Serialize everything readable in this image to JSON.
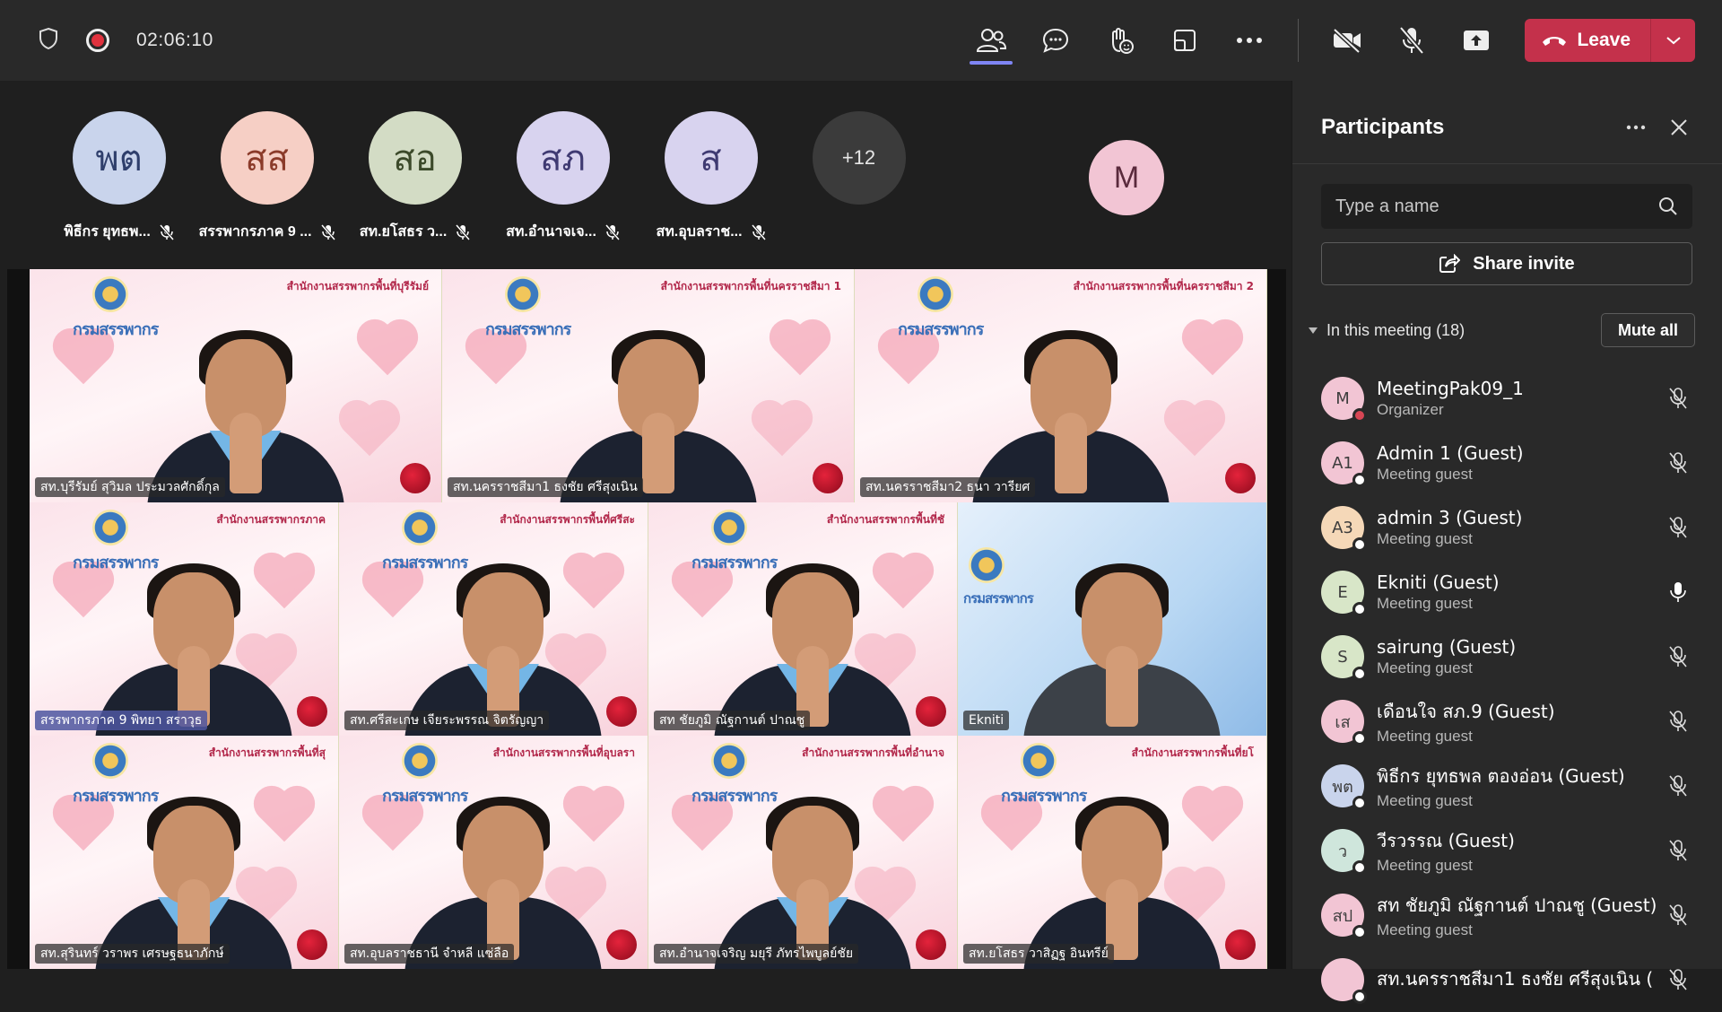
{
  "topbar": {
    "timer": "02:06:10",
    "leave_label": "Leave"
  },
  "stage": {
    "avatars": [
      {
        "initials": "พต",
        "name": "พิธีกร ยุทธพ...",
        "bg": "#c9d4ec",
        "fg": "#2f3f6c"
      },
      {
        "initials": "สส",
        "name": "สรรพากรภาค 9 ...",
        "bg": "#f6cfc5",
        "fg": "#8b3b2a"
      },
      {
        "initials": "สอ",
        "name": "สท.ยโสธร ว...",
        "bg": "#d3dcc5",
        "fg": "#3c4a2a"
      },
      {
        "initials": "สภ",
        "name": "สท.อำนาจเจ...",
        "bg": "#d8d3ef",
        "fg": "#3f3a72"
      },
      {
        "initials": "ส",
        "name": "สท.อุบลราช...",
        "bg": "#d8d3ef",
        "fg": "#3f3a72"
      }
    ],
    "overflow_count": "+12",
    "self_initial": "M"
  },
  "video_tiles": [
    {
      "label": "สท.บุรีรัมย์ สุวิมล ประมวลศักดิ์กุล",
      "caption": "สำนักงานสรรพากรพื้นที่บุรีรัมย์",
      "brand": "กรมสรรพากร"
    },
    {
      "label": "สท.นครราชสีมา1 ธงชัย ศรีสุงเนิน",
      "caption": "สำนักงานสรรพากรพื้นที่นครราชสีมา 1",
      "brand": "กรมสรรพากร"
    },
    {
      "label": "สท.นครราชสีมา2 ธนา วารียศ",
      "caption": "สำนักงานสรรพากรพื้นที่นครราชสีมา 2",
      "brand": "กรมสรรพากร"
    },
    {
      "label": "สรรพากรภาค 9 พิทยา สราวุธ",
      "caption": "สำนักงานสรรพากรภาค",
      "brand": "กรมสรรพากร"
    },
    {
      "label": "สท.ศรีสะเกษ เจียระพรรณ จิตรัญญา",
      "caption": "สำนักงานสรรพากรพื้นที่ศรีสะ",
      "brand": "กรมสรรพากร"
    },
    {
      "label": "สท ชัยภูมิ ณัฐกานต์ ปาณชู",
      "caption": "สำนักงานสรรพากรพื้นที่ชั",
      "brand": "กรมสรรพากร"
    },
    {
      "label": "Ekniti",
      "caption": "",
      "brand": "กรมสรรพากร"
    },
    {
      "label": "สท.สุรินทร์ วราพร เศรษฐธนาภักษ์",
      "caption": "สำนักงานสรรพากรพื้นที่สุ",
      "brand": "กรมสรรพากร"
    },
    {
      "label": "สท.อุบลราชธานี จำหลี แซ่ลือ",
      "caption": "สำนักงานสรรพากรพื้นที่อุบลรา",
      "brand": "กรมสรรพากร"
    },
    {
      "label": "สท.อำนาจเจริญ มยุรี ภัทรไพบูลย์ชัย",
      "caption": "สำนักงานสรรพากรพื้นที่อำนาจ",
      "brand": "กรมสรรพากร"
    },
    {
      "label": "สท.ยโสธร วาสิฏฐ อินทรีย์",
      "caption": "สำนักงานสรรพากรพื้นที่ยโ",
      "brand": "กรมสรรพากร"
    }
  ],
  "panel": {
    "title": "Participants",
    "search_placeholder": "Type a name",
    "share_label": "Share invite",
    "section_title": "In this meeting (18)",
    "mute_all_label": "Mute all",
    "participants": [
      {
        "initials": "M",
        "name": "MeetingPak09_1",
        "role": "Organizer",
        "bg": "#f2c5d4",
        "status": "busy",
        "mic": "muted"
      },
      {
        "initials": "A1",
        "name": "Admin 1 (Guest)",
        "role": "Meeting guest",
        "bg": "#f2c5d4",
        "status": "ok",
        "mic": "muted"
      },
      {
        "initials": "A3",
        "name": "admin 3 (Guest)",
        "role": "Meeting guest",
        "bg": "#f5d8b8",
        "status": "ok",
        "mic": "muted"
      },
      {
        "initials": "E",
        "name": "Ekniti (Guest)",
        "role": "Meeting guest",
        "bg": "#d8e6c8",
        "status": "ok",
        "mic": "on"
      },
      {
        "initials": "S",
        "name": "sairung (Guest)",
        "role": "Meeting guest",
        "bg": "#d8e6c8",
        "status": "ok",
        "mic": "muted"
      },
      {
        "initials": "เส",
        "name": "เดือนใจ สภ.9 (Guest)",
        "role": "Meeting guest",
        "bg": "#f2c5d4",
        "status": "ok",
        "mic": "muted"
      },
      {
        "initials": "พต",
        "name": "พิธีกร ยุทธพล ตองอ่อน (Guest)",
        "role": "Meeting guest",
        "bg": "#c9d4ec",
        "status": "ok",
        "mic": "muted"
      },
      {
        "initials": "ว",
        "name": "วีรวรรณ (Guest)",
        "role": "Meeting guest",
        "bg": "#cfe6dc",
        "status": "ok",
        "mic": "muted"
      },
      {
        "initials": "สป",
        "name": "สท ชัยภูมิ ณัฐกานต์ ปาณชู (Guest)",
        "role": "Meeting guest",
        "bg": "#f2c5d4",
        "status": "ok",
        "mic": "muted"
      },
      {
        "initials": "",
        "name": "สท.นครราชสีมา1 ธงชัย ศรีสุงเนิน (",
        "role": "",
        "bg": "#f2c5d4",
        "status": "ok",
        "mic": "muted"
      }
    ]
  }
}
